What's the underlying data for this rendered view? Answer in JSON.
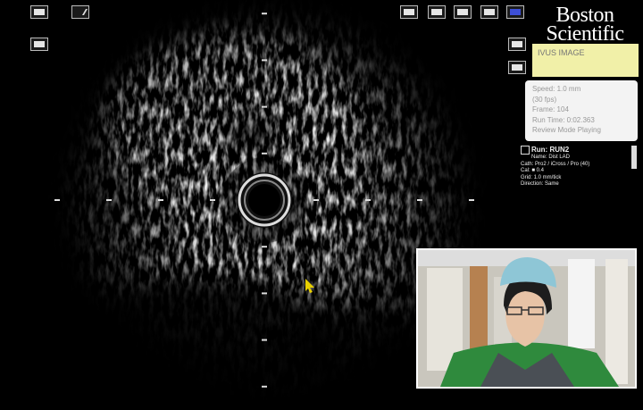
{
  "toolbar": {
    "left_icons": [
      "screen-icon",
      "edit-icon",
      "snapshot-icon"
    ],
    "right_icons": [
      "capture-icon",
      "back-icon",
      "print-icon",
      "export-icon",
      "display-icon",
      "contrast-icon",
      "save-icon"
    ]
  },
  "brand": {
    "line1": "Boston",
    "line2": "Scientific"
  },
  "info_box": {
    "text": "IVUS IMAGE"
  },
  "playback": {
    "speed": "Speed: 1.0 mm",
    "frame_rate": "  (30 fps)",
    "frame": "Frame: 104",
    "run_time": "Run Time: 0:02.363",
    "mode": "Review Mode Playing"
  },
  "run_info": {
    "run": "Run: RUN2",
    "name": "Name: Dist LAD",
    "cath": "Cath:  Pro2 / iCross / Pro (40)",
    "cal": "Cal: ■  0.4",
    "grid": "Grid:   1.0 mm/tick",
    "direction": "Direction:  Same"
  },
  "colors": {
    "background": "#000000",
    "info_box": "#f1f0a8",
    "panel": "#f3f3f3",
    "brand": "#ffffff",
    "cursor": "#e8d000"
  },
  "ivus": {
    "grid_tick_mm": 1.0
  }
}
